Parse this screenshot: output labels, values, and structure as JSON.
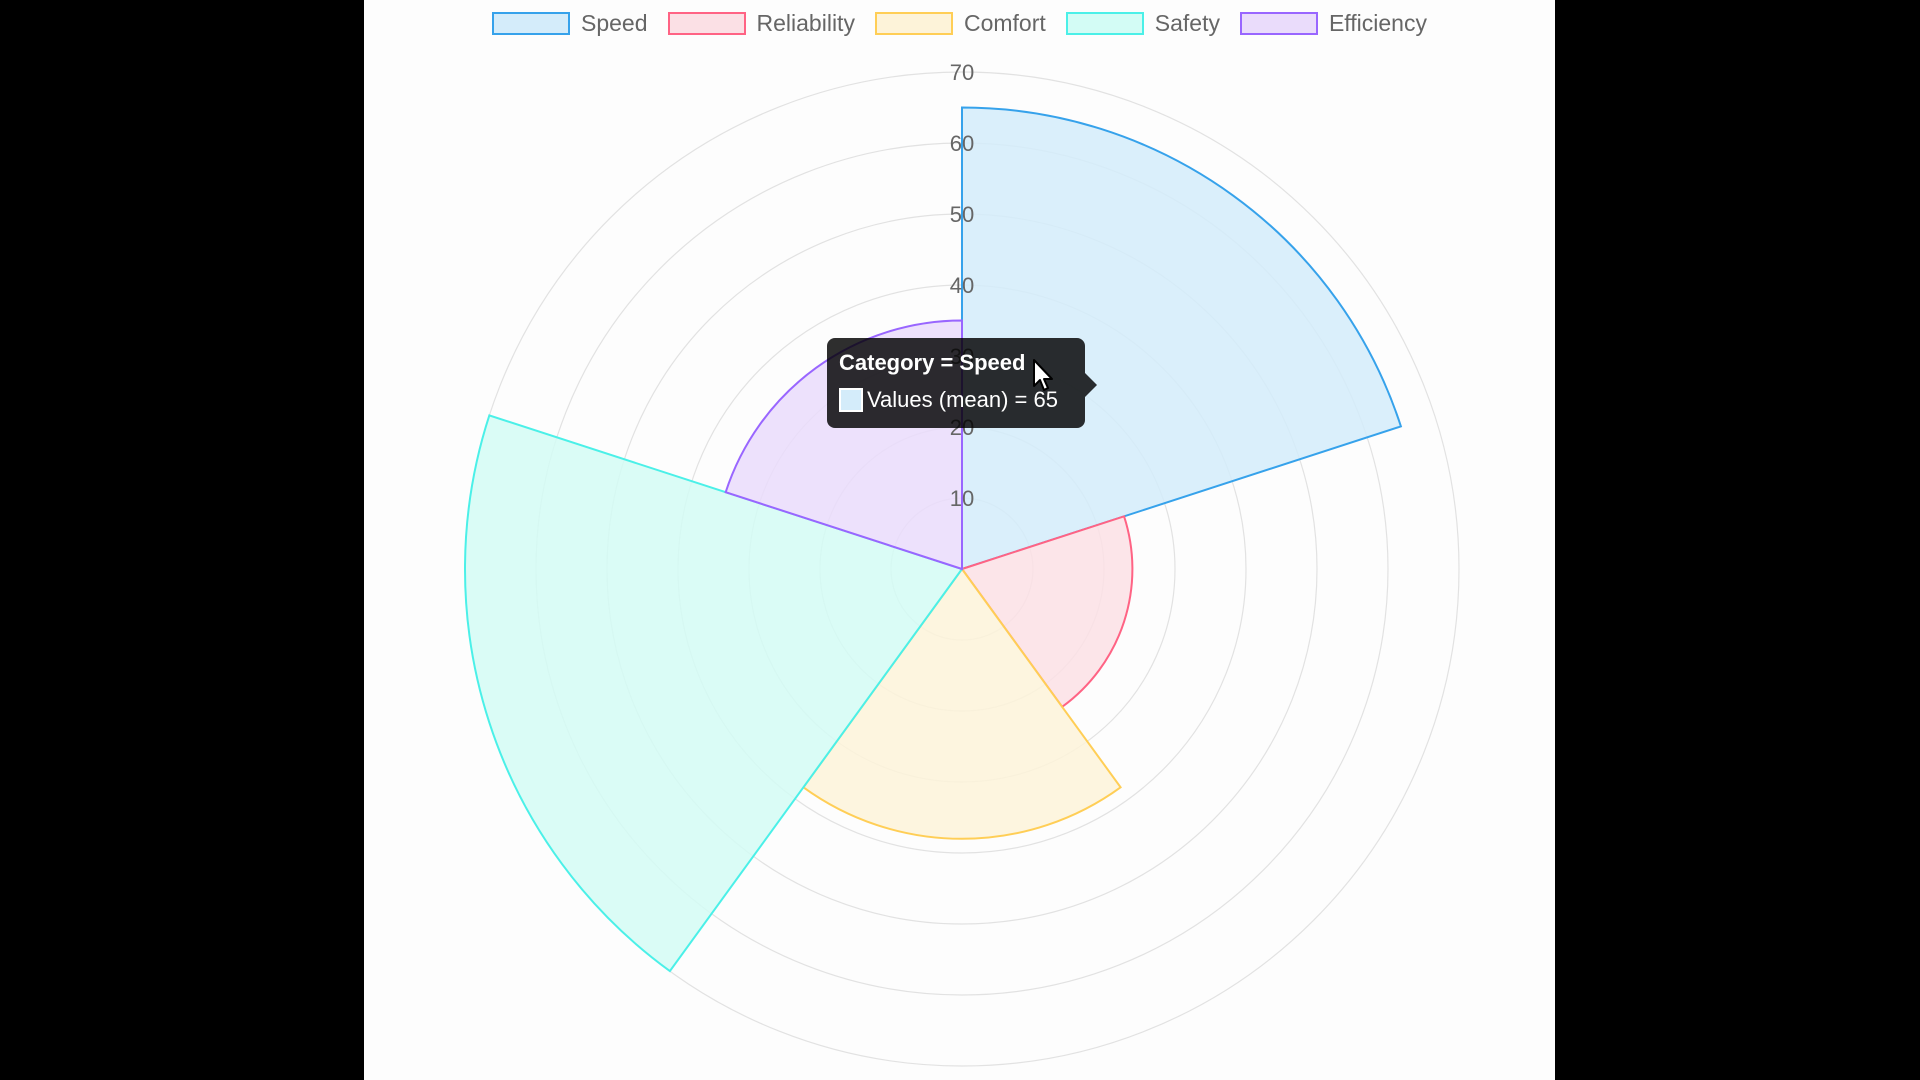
{
  "chart_data": {
    "type": "polarArea",
    "categories": [
      "Speed",
      "Reliability",
      "Comfort",
      "Safety",
      "Efficiency"
    ],
    "values": [
      65,
      24,
      38,
      70,
      35
    ],
    "radial_ticks": [
      "10",
      "20",
      "30",
      "40",
      "50",
      "60",
      "70"
    ],
    "r_range": [
      0,
      70
    ],
    "legend_position": "top",
    "grid": true,
    "colors": {
      "fill": [
        "#d4ecfa",
        "#fbe0e5",
        "#fdf3d9",
        "#d3fcf5",
        "#eadcfb"
      ],
      "stroke": [
        "#36a2eb",
        "#ff6384",
        "#ffce56",
        "#4bf0e8",
        "#9966ff"
      ]
    }
  },
  "tooltip": {
    "title": "Category = Speed",
    "body": "Values (mean) = 65",
    "swatch_color": "#d4ecfa"
  }
}
